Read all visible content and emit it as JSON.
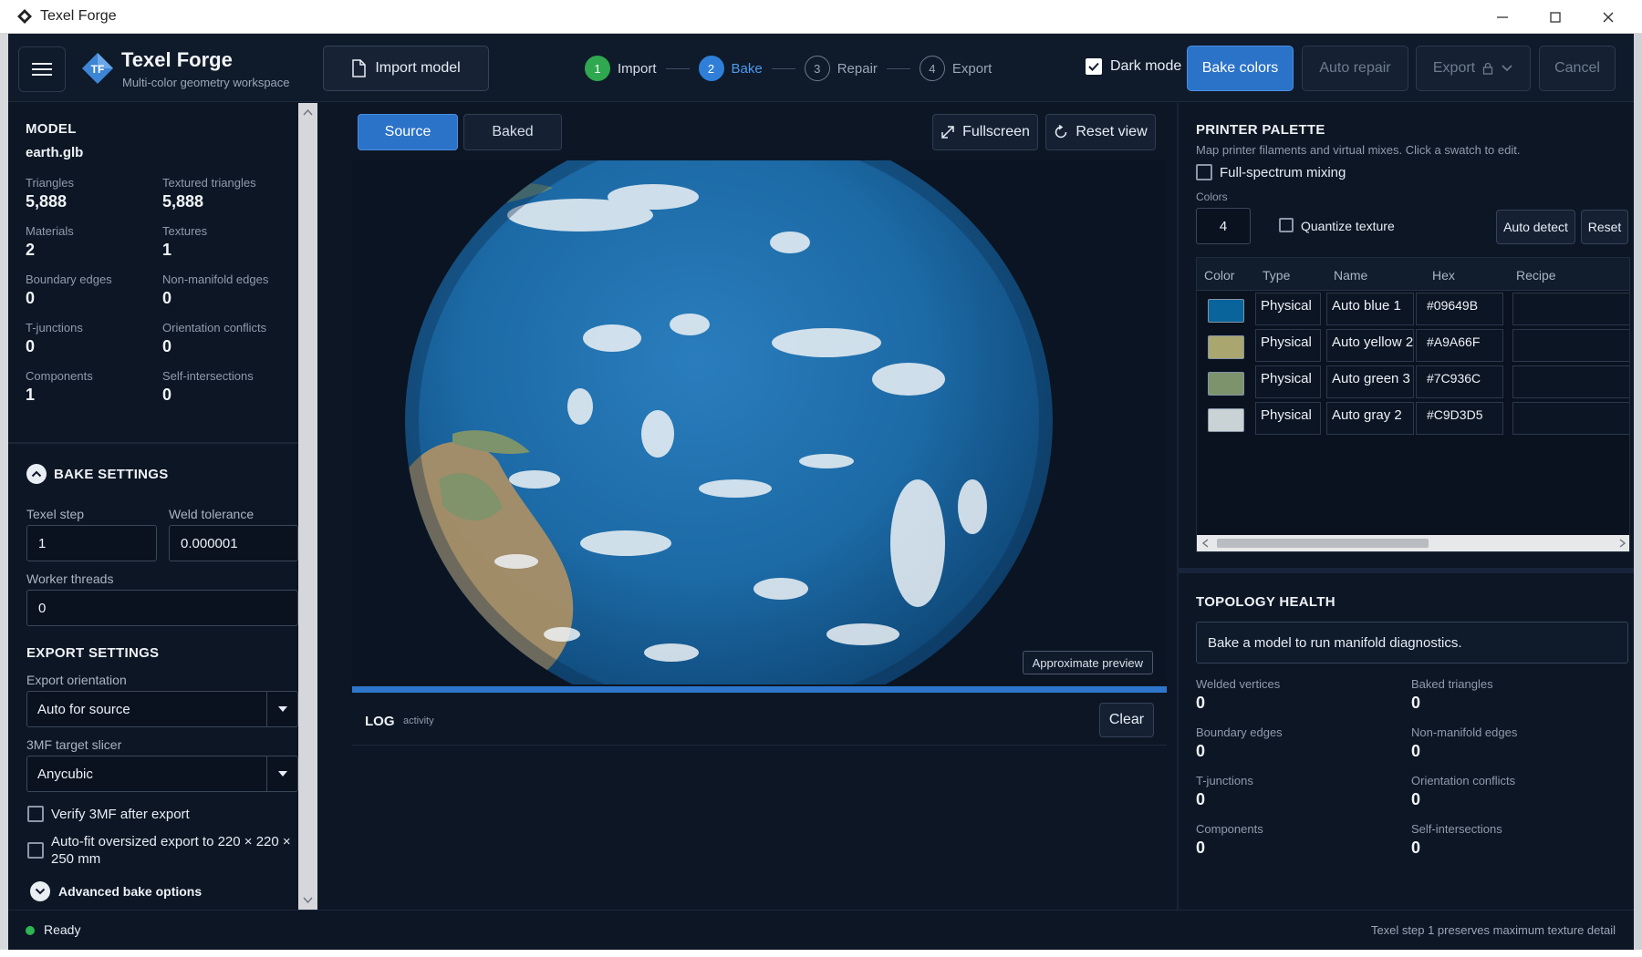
{
  "window": {
    "title": "Texel Forge"
  },
  "header": {
    "brand_title": "Texel Forge",
    "brand_subtitle": "Multi-color geometry workspace",
    "logo_text": "TF",
    "import_label": "Import model",
    "steps": [
      {
        "num": "1",
        "label": "Import",
        "state": "done"
      },
      {
        "num": "2",
        "label": "Bake",
        "state": "active"
      },
      {
        "num": "3",
        "label": "Repair",
        "state": "pending"
      },
      {
        "num": "4",
        "label": "Export",
        "state": "pending"
      }
    ],
    "dark_mode_label": "Dark mode",
    "dark_mode_checked": true,
    "bake_label": "Bake colors",
    "auto_repair_label": "Auto repair",
    "export_label": "Export",
    "cancel_label": "Cancel"
  },
  "model": {
    "section_title": "MODEL",
    "file_name": "earth.glb",
    "stats": [
      {
        "label": "Triangles",
        "value": "5,888"
      },
      {
        "label": "Textured triangles",
        "value": "5,888"
      },
      {
        "label": "Materials",
        "value": "2"
      },
      {
        "label": "Textures",
        "value": "1"
      },
      {
        "label": "Boundary edges",
        "value": "0"
      },
      {
        "label": "Non-manifold edges",
        "value": "0"
      },
      {
        "label": "T-junctions",
        "value": "0"
      },
      {
        "label": "Orientation conflicts",
        "value": "0"
      },
      {
        "label": "Components",
        "value": "1"
      },
      {
        "label": "Self-intersections",
        "value": "0"
      }
    ]
  },
  "bake_settings": {
    "title": "BAKE SETTINGS",
    "texel_step_label": "Texel step",
    "texel_step_value": "1",
    "weld_tolerance_label": "Weld tolerance",
    "weld_tolerance_value": "0.000001",
    "worker_threads_label": "Worker threads",
    "worker_threads_value": "0"
  },
  "export_settings": {
    "title": "EXPORT SETTINGS",
    "orientation_label": "Export orientation",
    "orientation_value": "Auto for source",
    "slicer_label": "3MF target slicer",
    "slicer_value": "Anycubic",
    "verify_label": "Verify 3MF after export",
    "autofit_label": "Auto-fit oversized export to 220 × 220 × 250 mm",
    "advanced_label": "Advanced bake options"
  },
  "viewer": {
    "source_label": "Source",
    "baked_label": "Baked",
    "fullscreen_label": "Fullscreen",
    "reset_view_label": "Reset view",
    "approx_label": "Approximate preview",
    "progress": 1.0
  },
  "log": {
    "title": "LOG",
    "tag": "activity",
    "clear_label": "Clear"
  },
  "palette": {
    "title": "PRINTER PALETTE",
    "subtitle": "Map printer filaments and virtual mixes. Click a swatch to edit.",
    "full_spectrum_label": "Full-spectrum mixing",
    "colors_label": "Colors",
    "colors_value": "4",
    "quantize_label": "Quantize texture",
    "auto_detect_label": "Auto detect",
    "reset_label": "Reset",
    "columns": [
      "Color",
      "Type",
      "Name",
      "Hex",
      "Recipe"
    ],
    "rows": [
      {
        "color": "#09649B",
        "type": "Physical",
        "name": "Auto blue 1",
        "hex": "#09649B"
      },
      {
        "color": "#A9A66F",
        "type": "Physical",
        "name": "Auto yellow 2",
        "hex": "#A9A66F"
      },
      {
        "color": "#7C936C",
        "type": "Physical",
        "name": "Auto green 3",
        "hex": "#7C936C"
      },
      {
        "color": "#C9D3D5",
        "type": "Physical",
        "name": "Auto gray 2",
        "hex": "#C9D3D5"
      }
    ]
  },
  "topology": {
    "title": "TOPOLOGY HEALTH",
    "message": "Bake a model to run manifold diagnostics.",
    "stats": [
      {
        "label": "Welded vertices",
        "value": "0"
      },
      {
        "label": "Baked triangles",
        "value": "0"
      },
      {
        "label": "Boundary edges",
        "value": "0"
      },
      {
        "label": "Non-manifold edges",
        "value": "0"
      },
      {
        "label": "T-junctions",
        "value": "0"
      },
      {
        "label": "Orientation conflicts",
        "value": "0"
      },
      {
        "label": "Components",
        "value": "0"
      },
      {
        "label": "Self-intersections",
        "value": "0"
      }
    ]
  },
  "status": {
    "text": "Ready",
    "right_text": "Texel step 1 preserves maximum texture detail"
  }
}
